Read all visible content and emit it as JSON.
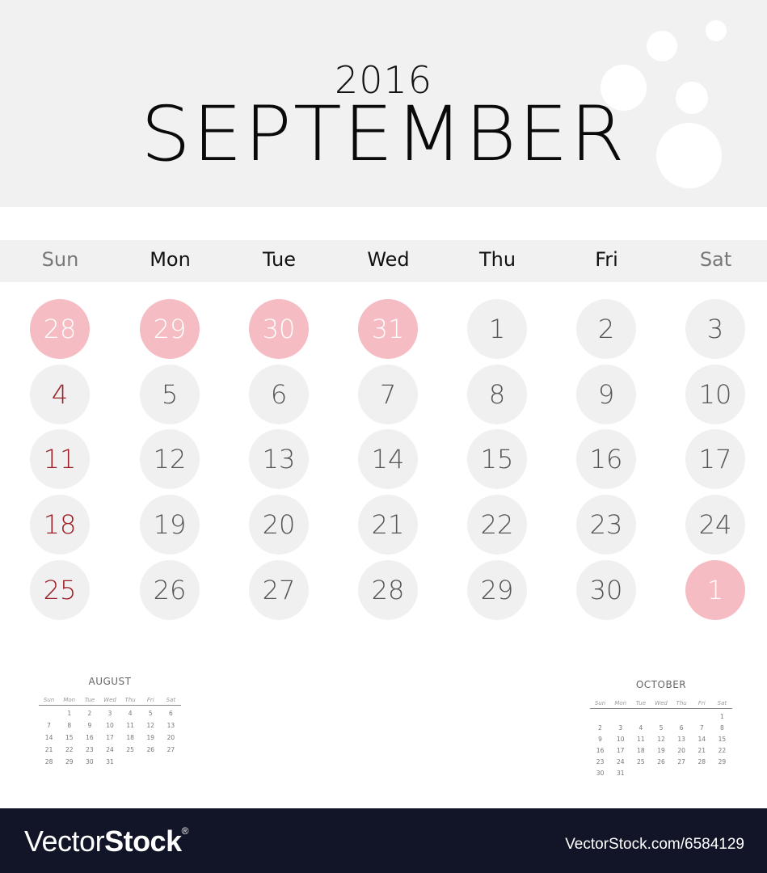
{
  "header": {
    "year": "2016",
    "month": "SEPTEMBER"
  },
  "weekdays": [
    "Sun",
    "Mon",
    "Tue",
    "Wed",
    "Thu",
    "Fri",
    "Sat"
  ],
  "grid": [
    [
      {
        "d": "28",
        "t": "other"
      },
      {
        "d": "29",
        "t": "other"
      },
      {
        "d": "30",
        "t": "other"
      },
      {
        "d": "31",
        "t": "other"
      },
      {
        "d": "1",
        "t": "current"
      },
      {
        "d": "2",
        "t": "current"
      },
      {
        "d": "3",
        "t": "current"
      }
    ],
    [
      {
        "d": "4",
        "t": "sunday"
      },
      {
        "d": "5",
        "t": "current"
      },
      {
        "d": "6",
        "t": "current"
      },
      {
        "d": "7",
        "t": "current"
      },
      {
        "d": "8",
        "t": "current"
      },
      {
        "d": "9",
        "t": "current"
      },
      {
        "d": "10",
        "t": "current"
      }
    ],
    [
      {
        "d": "11",
        "t": "sunday"
      },
      {
        "d": "12",
        "t": "current"
      },
      {
        "d": "13",
        "t": "current"
      },
      {
        "d": "14",
        "t": "current"
      },
      {
        "d": "15",
        "t": "current"
      },
      {
        "d": "16",
        "t": "current"
      },
      {
        "d": "17",
        "t": "current"
      }
    ],
    [
      {
        "d": "18",
        "t": "sunday"
      },
      {
        "d": "19",
        "t": "current"
      },
      {
        "d": "20",
        "t": "current"
      },
      {
        "d": "21",
        "t": "current"
      },
      {
        "d": "22",
        "t": "current"
      },
      {
        "d": "23",
        "t": "current"
      },
      {
        "d": "24",
        "t": "current"
      }
    ],
    [
      {
        "d": "25",
        "t": "sunday"
      },
      {
        "d": "26",
        "t": "current"
      },
      {
        "d": "27",
        "t": "current"
      },
      {
        "d": "28",
        "t": "current"
      },
      {
        "d": "29",
        "t": "current"
      },
      {
        "d": "30",
        "t": "current"
      },
      {
        "d": "1",
        "t": "other"
      }
    ]
  ],
  "mini_prev": {
    "title": "AUGUST",
    "weekdays": [
      "Sun",
      "Mon",
      "Tue",
      "Wed",
      "Thu",
      "Fri",
      "Sat"
    ],
    "days": [
      "",
      "1",
      "2",
      "3",
      "4",
      "5",
      "6",
      "7",
      "8",
      "9",
      "10",
      "11",
      "12",
      "13",
      "14",
      "15",
      "16",
      "17",
      "18",
      "19",
      "20",
      "21",
      "22",
      "23",
      "24",
      "25",
      "26",
      "27",
      "28",
      "29",
      "30",
      "31"
    ]
  },
  "mini_next": {
    "title": "OCTOBER",
    "weekdays": [
      "Sun",
      "Mon",
      "Tue",
      "Wed",
      "Thu",
      "Fri",
      "Sat"
    ],
    "days": [
      "",
      "",
      "",
      "",
      "",
      "",
      "1",
      "2",
      "3",
      "4",
      "5",
      "6",
      "7",
      "8",
      "9",
      "10",
      "11",
      "12",
      "13",
      "14",
      "15",
      "16",
      "17",
      "18",
      "19",
      "20",
      "21",
      "22",
      "23",
      "24",
      "25",
      "26",
      "27",
      "28",
      "29",
      "30",
      "31"
    ]
  },
  "footer": {
    "logo_light": "Vector",
    "logo_bold": "Stock",
    "logo_mark": "®",
    "reference": "VectorStock.com/6584129"
  },
  "colors": {
    "header_bg": "#f1f1f1",
    "other_month_fill": "#f5bcc4",
    "day_fill": "#f0f0f0",
    "sunday_text": "#9b1c24",
    "footer_bg": "#121427"
  }
}
